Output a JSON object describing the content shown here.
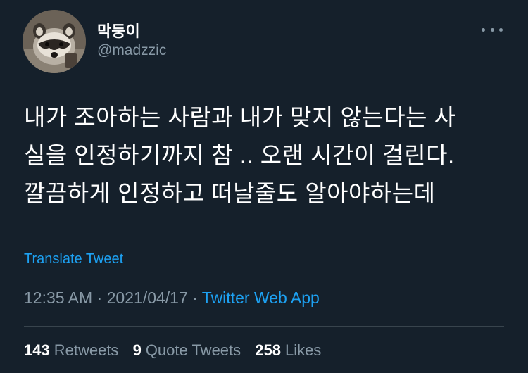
{
  "author": {
    "display_name": "막둥이",
    "handle": "@madzzic"
  },
  "menu": {
    "icon": "more-horizontal-icon"
  },
  "tweet": {
    "lines": [
      "내가 조아하는 사람과 내가 맞지 않는다는 사",
      "실을 인정하기까지 참 .. 오랜 시간이 걸린다.",
      "깔끔하게 인정하고 떠날줄도 알아야하는데"
    ]
  },
  "translate": {
    "label": "Translate Tweet"
  },
  "meta": {
    "time": "12:35 AM",
    "separator": "·",
    "date": "2021/04/17",
    "source": "Twitter Web App"
  },
  "stats": {
    "retweets_count": "143",
    "retweets_label": "Retweets",
    "quotes_count": "9",
    "quotes_label": "Quote Tweets",
    "likes_count": "258",
    "likes_label": "Likes"
  },
  "colors": {
    "background": "#15202b",
    "text": "#ffffff",
    "secondary": "#8899a6",
    "link": "#1da1f2",
    "divider": "#38444d"
  }
}
